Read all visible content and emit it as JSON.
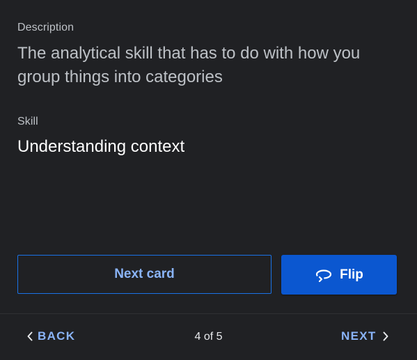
{
  "card": {
    "description_label": "Description",
    "description_text": "The analytical skill that has to do with how you group things into categories",
    "skill_label": "Skill",
    "skill_text": "Understanding context"
  },
  "actions": {
    "next_card_label": "Next card",
    "flip_label": "Flip",
    "flip_icon": "flip-rotate-icon"
  },
  "footer": {
    "back_label": "BACK",
    "next_label": "NEXT",
    "counter": "4 of 5"
  },
  "colors": {
    "background": "#202124",
    "accent_text": "#8ab4f8",
    "primary_button": "#0b57d0",
    "outline_border": "#1a73e8"
  }
}
